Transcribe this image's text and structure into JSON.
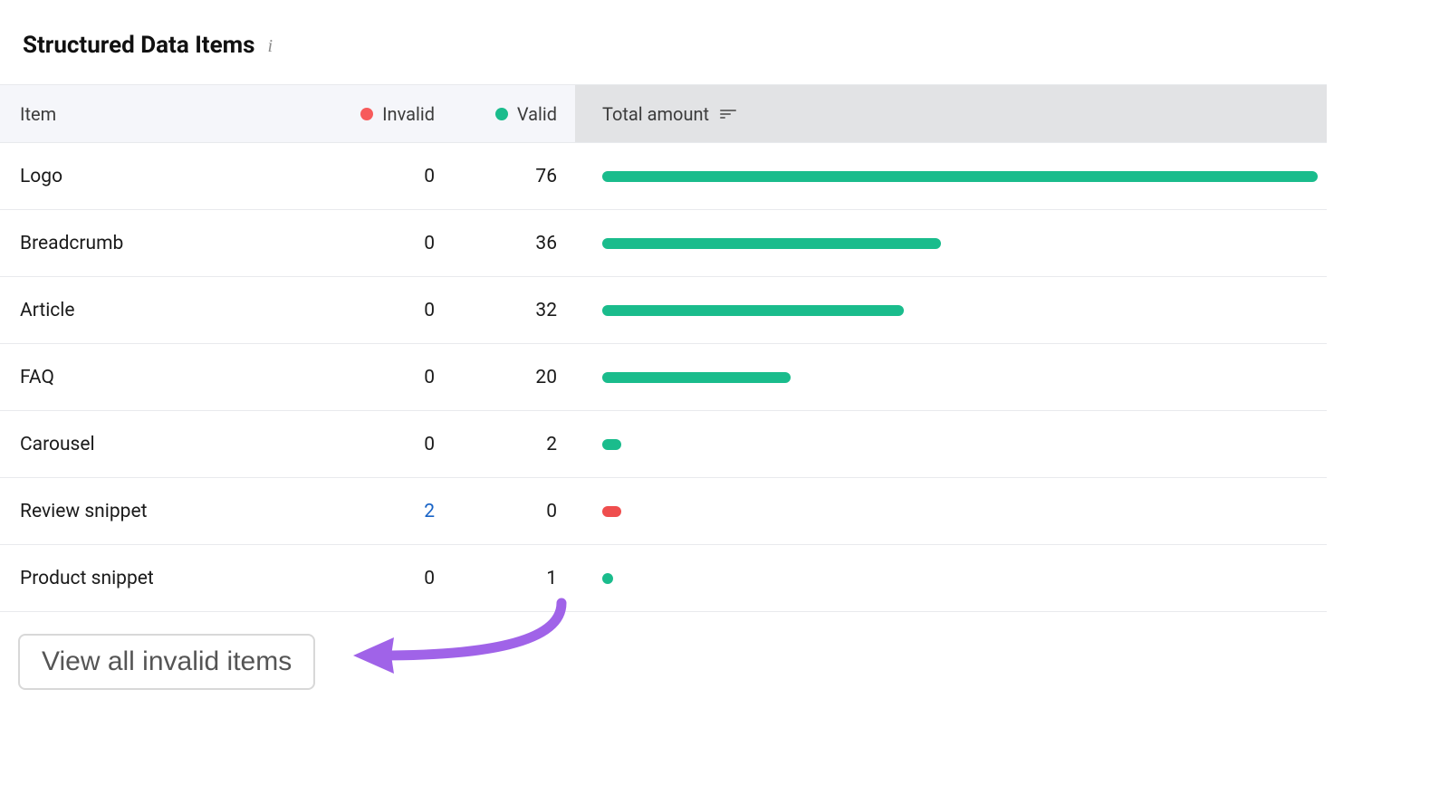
{
  "title": "Structured Data Items",
  "columns": {
    "item": "Item",
    "invalid": "Invalid",
    "valid": "Valid",
    "total": "Total amount"
  },
  "colors": {
    "invalid": "#f75b5b",
    "valid": "#1abc8c",
    "link": "#1863c6"
  },
  "max_total": 76,
  "rows": [
    {
      "item": "Logo",
      "invalid": 0,
      "valid": 76
    },
    {
      "item": "Breadcrumb",
      "invalid": 0,
      "valid": 36
    },
    {
      "item": "Article",
      "invalid": 0,
      "valid": 32
    },
    {
      "item": "FAQ",
      "invalid": 0,
      "valid": 20
    },
    {
      "item": "Carousel",
      "invalid": 0,
      "valid": 2
    },
    {
      "item": "Review snippet",
      "invalid": 2,
      "valid": 0
    },
    {
      "item": "Product snippet",
      "invalid": 0,
      "valid": 1
    }
  ],
  "chart_data": {
    "type": "bar",
    "title": "Structured Data Items",
    "categories": [
      "Logo",
      "Breadcrumb",
      "Article",
      "FAQ",
      "Carousel",
      "Review snippet",
      "Product snippet"
    ],
    "series": [
      {
        "name": "Invalid",
        "color": "#f75b5b",
        "values": [
          0,
          0,
          0,
          0,
          0,
          2,
          0
        ]
      },
      {
        "name": "Valid",
        "color": "#1abc8c",
        "values": [
          76,
          36,
          32,
          20,
          2,
          0,
          1
        ]
      }
    ],
    "xlabel": "Total amount",
    "ylim": [
      0,
      76
    ]
  },
  "footer": {
    "button": "View all invalid items"
  }
}
